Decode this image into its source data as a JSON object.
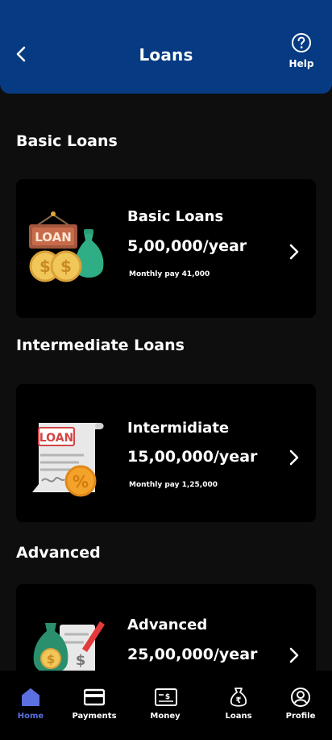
{
  "header": {
    "title": "Loans",
    "help_label": "Help"
  },
  "sections": [
    {
      "title": "Basic Loans"
    },
    {
      "title": "Intermediate Loans"
    },
    {
      "title": "Advanced"
    }
  ],
  "cards": [
    {
      "name": "Basic Loans",
      "amount": "5,00,000/year",
      "monthly": "Monthly pay 41,000",
      "sign_text": "LOAN"
    },
    {
      "name": "Intermidiate",
      "amount": "15,00,000/year",
      "monthly": "Monthly pay 1,25,000",
      "sign_text": "LOAN"
    },
    {
      "name": "Advanced",
      "amount": "25,00,000/year"
    }
  ],
  "nav": [
    {
      "label": "Home",
      "icon": "home-icon",
      "active": true
    },
    {
      "label": "Payments",
      "icon": "card-icon"
    },
    {
      "label": "Money",
      "icon": "money-icon"
    },
    {
      "label": "Loans",
      "icon": "rupee-bag-icon"
    },
    {
      "label": "Profile",
      "icon": "profile-icon"
    }
  ],
  "colors": {
    "header": "#063a82",
    "background": "#0e0e0e",
    "card": "#000000",
    "active_nav": "#5a6fe0"
  }
}
